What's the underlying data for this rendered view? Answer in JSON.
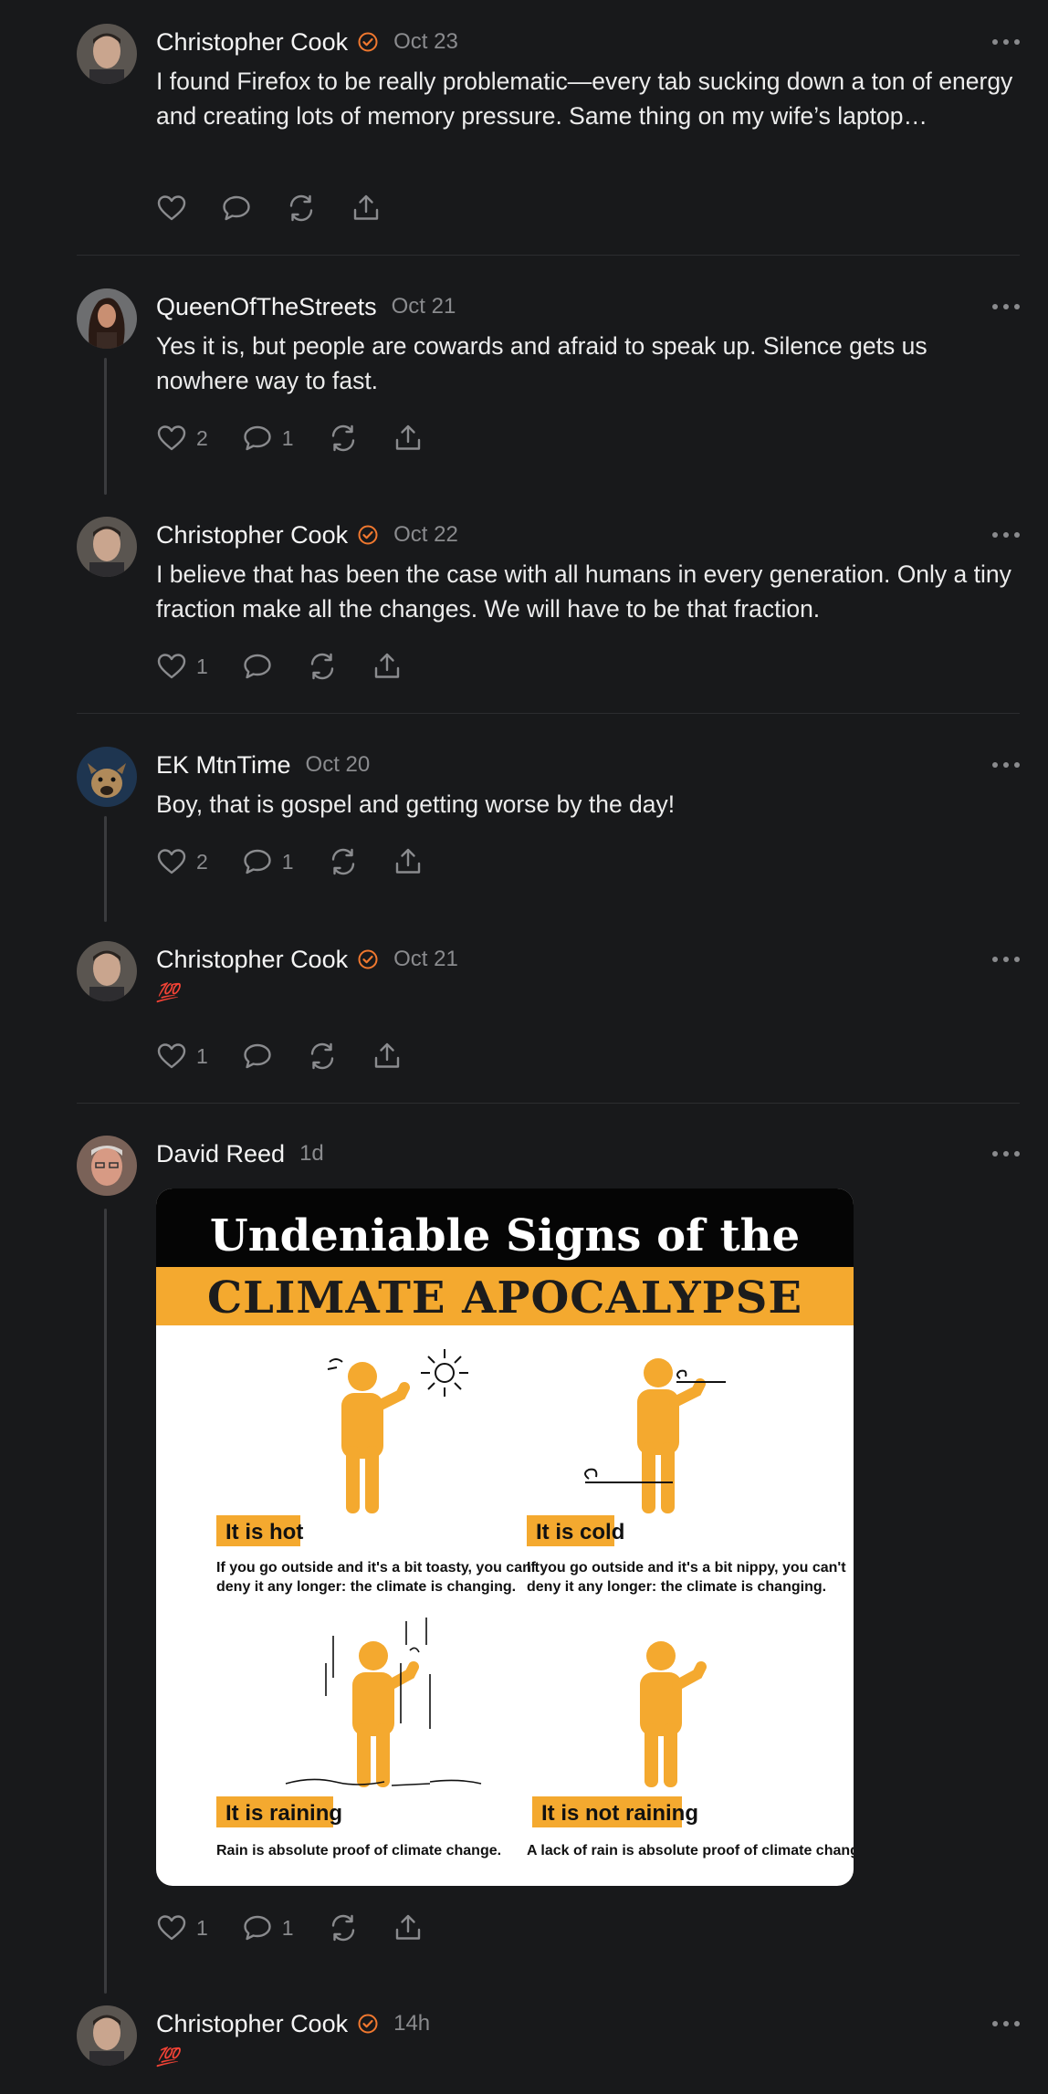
{
  "posts": [
    {
      "author": "Christopher Cook",
      "verified": true,
      "date": "Oct 23",
      "text": "I found Firefox to be really problematic—every tab sucking down a ton of energy and creating lots of memory pressure. Same thing on my wife’s laptop…",
      "likes": "",
      "replies": ""
    },
    {
      "author": "QueenOfTheStreets",
      "verified": false,
      "date": "Oct 21",
      "text": "Yes it is, but people are cowards and afraid to speak up. Silence gets us nowhere way to fast.",
      "likes": "2",
      "replies": "1"
    },
    {
      "author": "Christopher Cook",
      "verified": true,
      "date": "Oct 22",
      "text": "I believe that has been the case with all humans in every generation. Only a tiny fraction make all the changes. We will have to be that fraction.",
      "likes": "1",
      "replies": ""
    },
    {
      "author": "EK MtnTime",
      "verified": false,
      "date": "Oct 20",
      "text": "Boy, that is gospel and getting worse by the day!",
      "likes": "2",
      "replies": "1"
    },
    {
      "author": "Christopher Cook",
      "verified": true,
      "date": "Oct 21",
      "text": "💯",
      "likes": "1",
      "replies": ""
    },
    {
      "author": "David Reed",
      "verified": false,
      "date": "1d",
      "text": "",
      "likes": "1",
      "replies": "1"
    },
    {
      "author": "Christopher Cook",
      "verified": true,
      "date": "14h",
      "text": "💯",
      "likes": "",
      "replies": ""
    }
  ],
  "meme": {
    "title_line1": "Undeniable Signs of the",
    "title_line2": "CLIMATE APOCALYPSE",
    "panels": [
      {
        "label": "It is hot",
        "caption1": "If you go outside and it's a bit toasty, you can't",
        "caption2": "deny it any longer: the climate is changing."
      },
      {
        "label": "It is cold",
        "caption1": "If you go outside and it's a bit nippy, you can't",
        "caption2": "deny it any longer: the climate is changing."
      },
      {
        "label": "It is raining",
        "caption1": "Rain is absolute proof of climate change.",
        "caption2": ""
      },
      {
        "label": "It is not raining",
        "caption1": "A lack of rain is absolute proof of climate change.",
        "caption2": ""
      }
    ],
    "accent": "#f4a92f"
  },
  "colors": {
    "background": "#18191b",
    "verified": "#f0782f",
    "muted": "#8a8b8e"
  }
}
